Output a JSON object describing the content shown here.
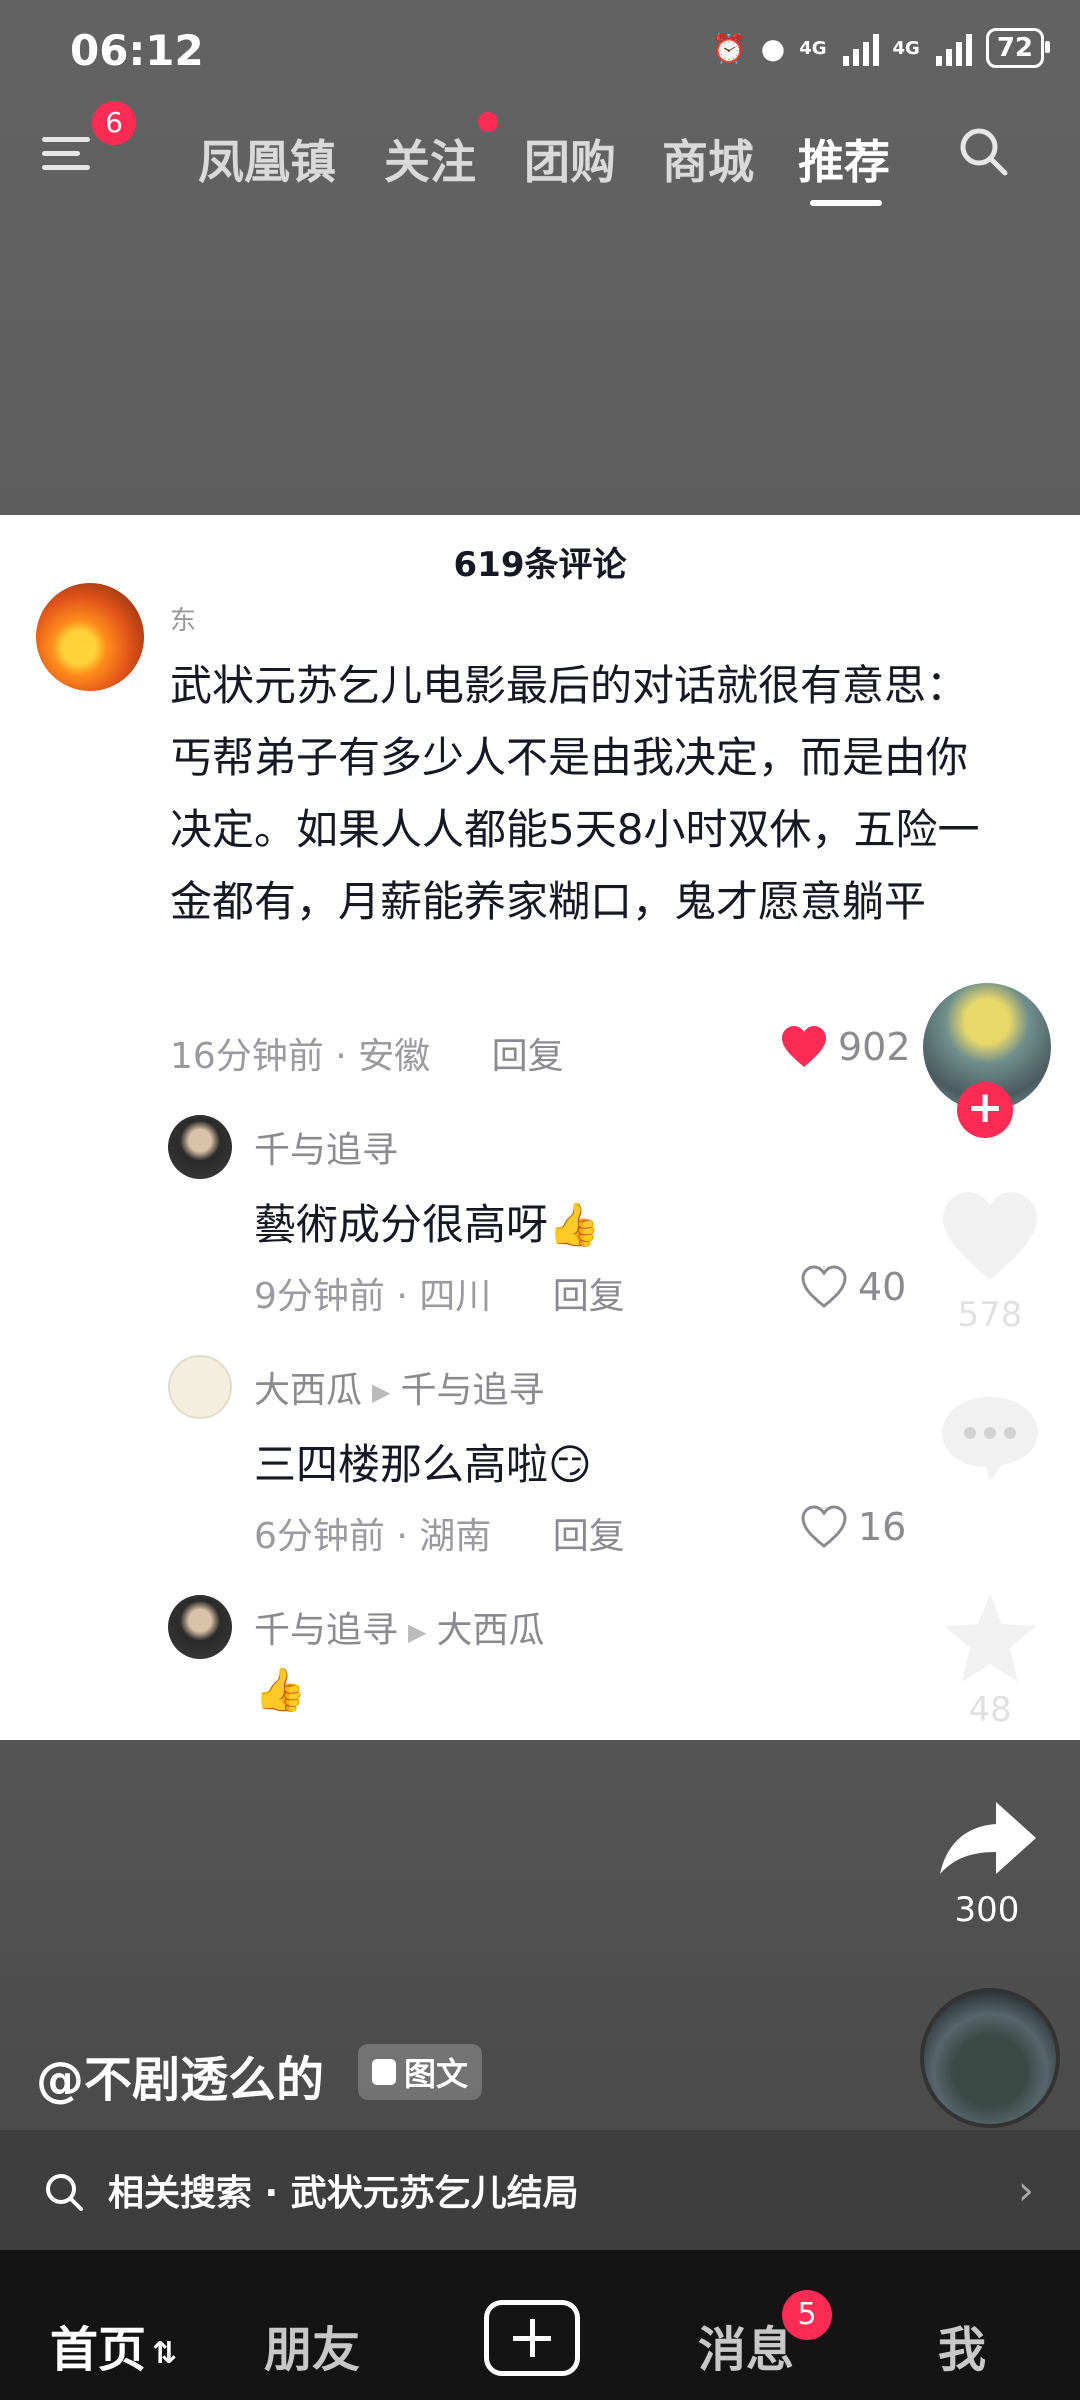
{
  "status_bar": {
    "time": "06:12",
    "network_1": "4G",
    "network_2": "4G",
    "battery": "72"
  },
  "top_nav": {
    "menu_badge": "6",
    "tabs": [
      "凤凰镇",
      "关注",
      "团购",
      "商城",
      "推荐"
    ],
    "active_tab": "推荐"
  },
  "comments": {
    "header": "619条评论",
    "main": {
      "username": "东",
      "text": "武状元苏乞儿电影最后的对话就很有意思：丐帮弟子有多少人不是由我决定，而是由你决定。如果人人都能5天8小时双休，五险一金都有，月薪能养家糊口，鬼才愿意躺平",
      "time_location": "16分钟前 · 安徽",
      "reply_label": "回复",
      "likes": "902"
    },
    "replies": [
      {
        "username": "千与追寻",
        "reply_to": "",
        "text": "藝術成分很高呀👍",
        "time_location": "9分钟前 · 四川",
        "reply_label": "回复",
        "likes": "40"
      },
      {
        "username": "大西瓜",
        "reply_to": "千与追寻",
        "text": "三四楼那么高啦😏",
        "time_location": "6分钟前 · 湖南",
        "reply_label": "回复",
        "likes": "16"
      },
      {
        "username": "千与追寻",
        "reply_to": "大西瓜",
        "text": "👍",
        "time_location": "",
        "reply_label": "",
        "likes": ""
      }
    ]
  },
  "side_actions": {
    "likes": "578",
    "comments": "",
    "favorites": "48",
    "shares": "300"
  },
  "video": {
    "author": "@不剧透么的",
    "type_label": "图文",
    "related_search": "相关搜索 · 武状元苏乞儿结局"
  },
  "bottom_nav": {
    "home": "首页",
    "friends": "朋友",
    "messages": "消息",
    "messages_badge": "5",
    "me": "我"
  },
  "colors": {
    "accent": "#fe2c55",
    "panel_bg": "#ffffff",
    "dim_bg": "#5a5a5a"
  }
}
